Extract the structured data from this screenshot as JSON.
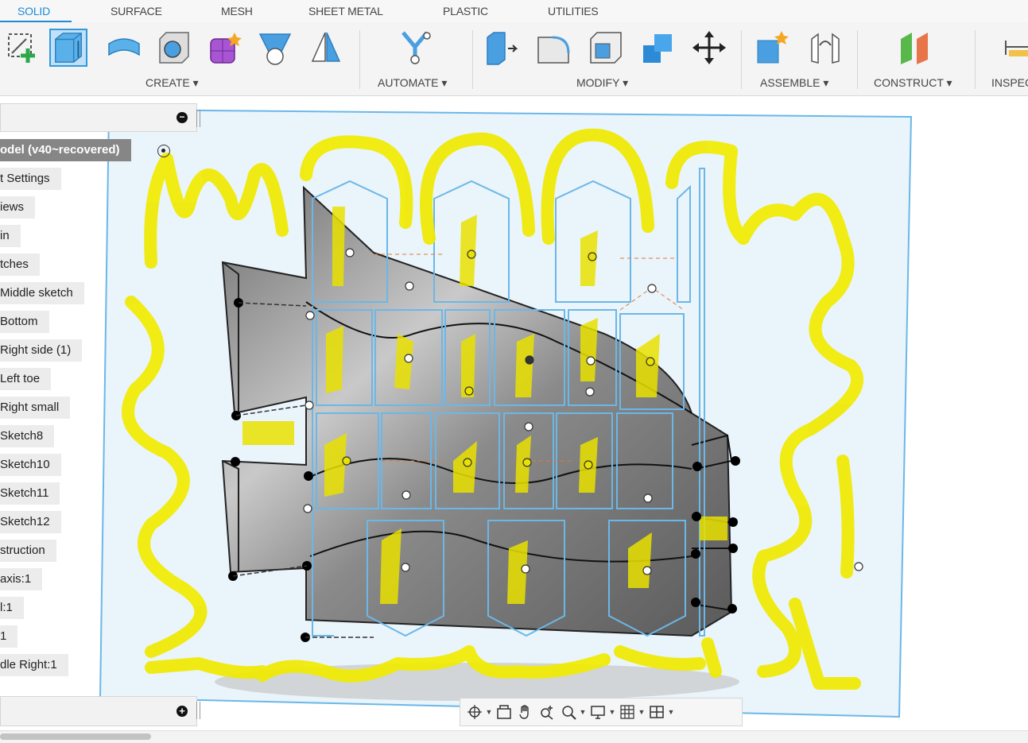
{
  "tabs": [
    {
      "label": "SOLID",
      "active": true
    },
    {
      "label": "SURFACE"
    },
    {
      "label": "MESH"
    },
    {
      "label": "SHEET METAL"
    },
    {
      "label": "PLASTIC"
    },
    {
      "label": "UTILITIES"
    }
  ],
  "toolbar": {
    "groups": [
      {
        "label": "CREATE ▾"
      },
      {
        "label": "AUTOMATE ▾"
      },
      {
        "label": "MODIFY ▾"
      },
      {
        "label": "ASSEMBLE ▾"
      },
      {
        "label": "CONSTRUCT ▾"
      },
      {
        "label": "INSPEC"
      }
    ],
    "tools": [
      "create-sketch-icon",
      "extrude-icon",
      "revolve-icon",
      "hole-icon",
      "form-icon",
      "loft-icon",
      "mirror-icon",
      "automate-icon",
      "press-pull-icon",
      "fillet-icon",
      "shell-icon",
      "combine-icon",
      "move-icon",
      "new-component-icon",
      "joint-icon",
      "offset-plane-icon",
      "measure-icon"
    ]
  },
  "browser": {
    "items": [
      {
        "label": "odel (v40~recovered)",
        "root": true
      },
      {
        "label": "t Settings"
      },
      {
        "label": "iews"
      },
      {
        "label": "in"
      },
      {
        "label": "tches"
      },
      {
        "label": "Middle sketch"
      },
      {
        "label": "Bottom"
      },
      {
        "label": "Right side (1)"
      },
      {
        "label": "Left toe"
      },
      {
        "label": "Right small"
      },
      {
        "label": "Sketch8"
      },
      {
        "label": "Sketch10"
      },
      {
        "label": "Sketch11"
      },
      {
        "label": "Sketch12"
      },
      {
        "label": "struction"
      },
      {
        "label": "axis:1"
      },
      {
        "label": "l:1"
      },
      {
        "label": "1"
      },
      {
        "label": "dle Right:1"
      }
    ],
    "collapse_symbol": "−",
    "comments_symbol": "+"
  },
  "nav": {
    "buttons": [
      "orbit-icon",
      "look-at-icon",
      "pan-icon",
      "zoom-icon",
      "fit-icon",
      "display-settings-icon",
      "grid-icon",
      "viewports-icon"
    ]
  },
  "colors": {
    "accent": "#1f8ad6",
    "highlighter": "#f0ea00",
    "sketch": "#6bb7e8",
    "plane": "#eaf4fb"
  }
}
